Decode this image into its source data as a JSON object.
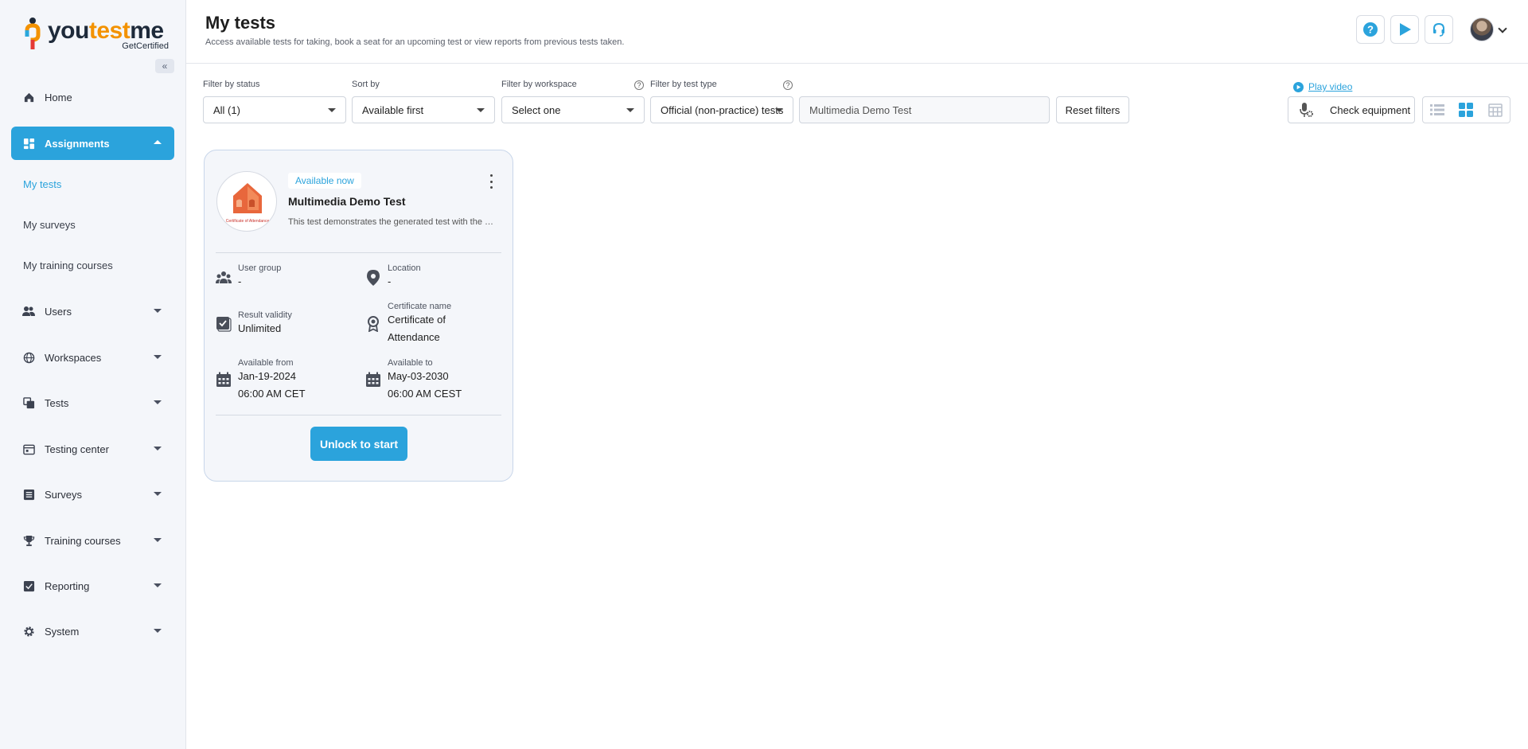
{
  "brand": {
    "name_part1": "you",
    "name_part2": "test",
    "name_part3": "me",
    "sub": "GetCertified"
  },
  "sidebar": {
    "collapse_label": "«",
    "items": [
      {
        "label": "Home",
        "icon": "home-icon"
      },
      {
        "label": "Assignments",
        "icon": "assignments-icon",
        "active": true
      },
      {
        "label": "Users",
        "icon": "users-icon"
      },
      {
        "label": "Workspaces",
        "icon": "globe-icon"
      },
      {
        "label": "Tests",
        "icon": "tests-icon"
      },
      {
        "label": "Testing center",
        "icon": "calendar-icon"
      },
      {
        "label": "Surveys",
        "icon": "list-icon"
      },
      {
        "label": "Training courses",
        "icon": "trophy-icon"
      },
      {
        "label": "Reporting",
        "icon": "reporting-icon"
      },
      {
        "label": "System",
        "icon": "gear-icon"
      }
    ],
    "sub_items": [
      {
        "label": "My tests",
        "active": true
      },
      {
        "label": "My surveys"
      },
      {
        "label": "My training courses"
      }
    ]
  },
  "header": {
    "title": "My tests",
    "description": "Access available tests for taking, book a seat for an upcoming test or view reports from previous tests taken."
  },
  "filters": {
    "status": {
      "label": "Filter by status",
      "value": "All (1)"
    },
    "sort": {
      "label": "Sort by",
      "value": "Available first"
    },
    "workspace": {
      "label": "Filter by workspace",
      "value": "Select one"
    },
    "test_type": {
      "label": "Filter by test type",
      "value": "Official (non-practice) tests"
    },
    "search": {
      "value": "Multimedia Demo Test"
    },
    "reset_label": "Reset filters",
    "play_video_label": "Play video",
    "check_equipment_label": "Check equipment"
  },
  "card": {
    "status": "Available now",
    "title": "Multimedia Demo Test",
    "description": "This test demonstrates the generated test with the multimedia questions",
    "cert_image_text": "Certificate of Attendance",
    "user_group": {
      "label": "User group",
      "value": "-"
    },
    "location": {
      "label": "Location",
      "value": "-"
    },
    "result_validity": {
      "label": "Result validity",
      "value": "Unlimited"
    },
    "certificate": {
      "label": "Certificate name",
      "line1": "Certificate of",
      "line2": "Attendance"
    },
    "available_from": {
      "label": "Available from",
      "date": "Jan-19-2024",
      "time": "06:00 AM CET"
    },
    "available_to": {
      "label": "Available to",
      "date": "May-03-2030",
      "time": "06:00 AM CEST"
    },
    "button_label": "Unlock to start"
  },
  "colors": {
    "accent": "#2ba3dc",
    "brand_orange": "#f39200"
  }
}
